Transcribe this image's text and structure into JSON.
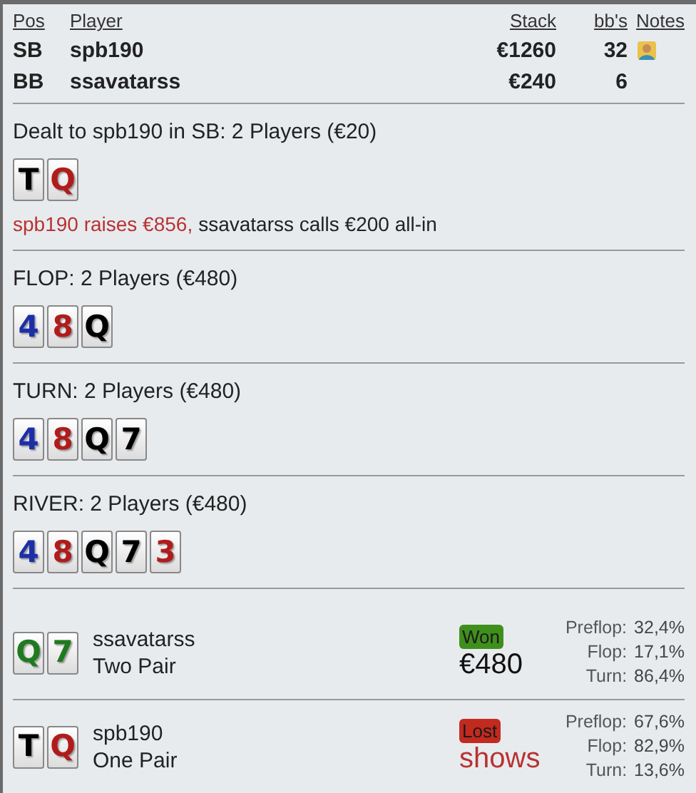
{
  "columns": {
    "pos": "Pos",
    "player": "Player",
    "stack": "Stack",
    "bbs": "bb's",
    "notes": "Notes"
  },
  "players": [
    {
      "pos": "SB",
      "name": "spb190",
      "stack": "€1260",
      "bbs": "32",
      "notes": true
    },
    {
      "pos": "BB",
      "name": "ssavatarss",
      "stack": "€240",
      "bbs": "6",
      "notes": false
    }
  ],
  "streets": [
    {
      "title": "Dealt to spb190 in SB: 2 Players (€20)",
      "cards": [
        {
          "rank": "T",
          "color": "#000000"
        },
        {
          "rank": "Q",
          "color": "#b01c1c"
        }
      ],
      "actions": [
        {
          "text": "spb190 raises €856,",
          "color": "#b83232"
        },
        {
          "text": "ssavatarss calls €200 all-in",
          "color": "#222222"
        }
      ]
    },
    {
      "title": "FLOP: 2 Players (€480)",
      "cards": [
        {
          "rank": "4",
          "color": "#1c2fa8"
        },
        {
          "rank": "8",
          "color": "#b01c1c"
        },
        {
          "rank": "Q",
          "color": "#000000"
        }
      ]
    },
    {
      "title": "TURN: 2 Players (€480)",
      "cards": [
        {
          "rank": "4",
          "color": "#1c2fa8"
        },
        {
          "rank": "8",
          "color": "#b01c1c"
        },
        {
          "rank": "Q",
          "color": "#000000"
        },
        {
          "rank": "7",
          "color": "#000000"
        }
      ]
    },
    {
      "title": "RIVER: 2 Players (€480)",
      "cards": [
        {
          "rank": "4",
          "color": "#1c2fa8"
        },
        {
          "rank": "8",
          "color": "#b01c1c"
        },
        {
          "rank": "Q",
          "color": "#000000"
        },
        {
          "rank": "7",
          "color": "#000000"
        },
        {
          "rank": "3",
          "color": "#b01c1c"
        }
      ]
    }
  ],
  "showdown": [
    {
      "cards": [
        {
          "rank": "Q",
          "color": "#1f7a1f"
        },
        {
          "rank": "7",
          "color": "#1f7a1f"
        }
      ],
      "name": "ssavatarss",
      "hand": "Two Pair",
      "kind": "won",
      "badge": "Won",
      "amount": "€480",
      "equity": [
        {
          "label": "Preflop:",
          "value": "32,4%"
        },
        {
          "label": "Flop:",
          "value": "17,1%"
        },
        {
          "label": "Turn:",
          "value": "86,4%"
        }
      ]
    },
    {
      "cards": [
        {
          "rank": "T",
          "color": "#000000"
        },
        {
          "rank": "Q",
          "color": "#b01c1c"
        }
      ],
      "name": "spb190",
      "hand": "One Pair",
      "kind": "lost",
      "badge": "Lost",
      "amount": "shows",
      "equity": [
        {
          "label": "Preflop:",
          "value": "67,6%"
        },
        {
          "label": "Flop:",
          "value": "82,9%"
        },
        {
          "label": "Turn:",
          "value": "13,6%"
        }
      ]
    }
  ]
}
